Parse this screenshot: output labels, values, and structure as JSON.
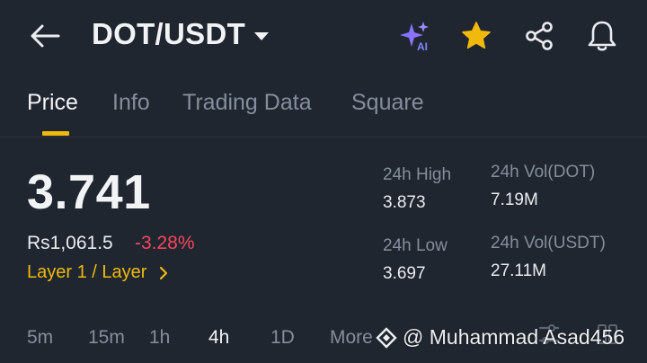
{
  "header": {
    "pair": "DOT/USDT",
    "icons": [
      "back-arrow-icon",
      "ai-sparkle-icon",
      "star-icon",
      "share-icon",
      "bell-icon"
    ],
    "ai_badge": "AI"
  },
  "tabs": [
    {
      "label": "Price",
      "active": true
    },
    {
      "label": "Info"
    },
    {
      "label": "Trading Data"
    },
    {
      "label": "Square"
    }
  ],
  "price": {
    "last": "3.741",
    "local": "Rs1,061.5",
    "change": "-3.28%",
    "category": "Layer 1 / Layer"
  },
  "stats": {
    "high_label": "24h High",
    "high_value": "3.873",
    "low_label": "24h Low",
    "low_value": "3.697",
    "vol_base_label": "24h Vol(DOT)",
    "vol_base_value": "7.19M",
    "vol_quote_label": "24h Vol(USDT)",
    "vol_quote_value": "27.11M"
  },
  "intervals": [
    {
      "label": "5m"
    },
    {
      "label": "15m"
    },
    {
      "label": "1h"
    },
    {
      "label": "4h",
      "active": true
    },
    {
      "label": "1D"
    },
    {
      "label": "More"
    }
  ],
  "watermark": {
    "text": "@ Muhammad Asad456"
  },
  "colors": {
    "background": "#1f2630",
    "accent": "#f0b90b",
    "negative": "#f6465d",
    "muted": "#848e9c",
    "ai_gradient_start": "#6b7bff",
    "ai_gradient_end": "#9d6bff"
  }
}
